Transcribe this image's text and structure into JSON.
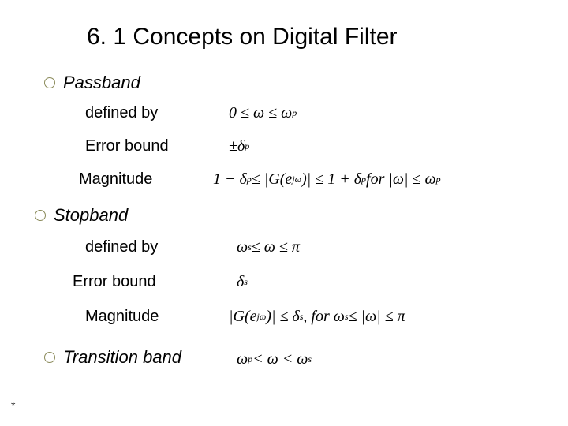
{
  "title": "6. 1 Concepts on Digital Filter",
  "passband": {
    "heading": "Passband",
    "defined_label": "defined by",
    "defined_math": "0 ≤ ω ≤ ω",
    "defined_sub": "p",
    "error_label": "Error bound",
    "error_math_pm": "±δ",
    "error_sub": "p",
    "mag_label": "Magnitude",
    "mag_left": "1 − δ",
    "mag_left_sub": "p",
    "mag_mid": " ≤ |G(e",
    "mag_exp": "jω",
    "mag_mid2": ")| ≤ 1 + δ",
    "mag_right_sub": "p",
    "mag_for": "   for |ω| ≤ ω",
    "mag_for_sub": "p"
  },
  "stopband": {
    "heading": "Stopband",
    "defined_label": "defined by",
    "defined_math_l": "ω",
    "defined_sub_l": "s",
    "defined_math_r": " ≤ ω ≤ π",
    "error_label": "Error bound",
    "error_math": "δ",
    "error_sub": "s",
    "mag_label": "Magnitude",
    "mag_left": "|G(e",
    "mag_exp": "jω",
    "mag_mid": ")| ≤ δ",
    "mag_sub": "s",
    "mag_for": ",  for  ω",
    "mag_for_sub1": "s",
    "mag_for_mid": " ≤ |ω| ≤ π"
  },
  "transition": {
    "heading": "Transition band",
    "math_l": "ω",
    "sub_l": "p",
    "math_mid": " < ω < ω",
    "sub_r": "s"
  },
  "footnote": "*"
}
